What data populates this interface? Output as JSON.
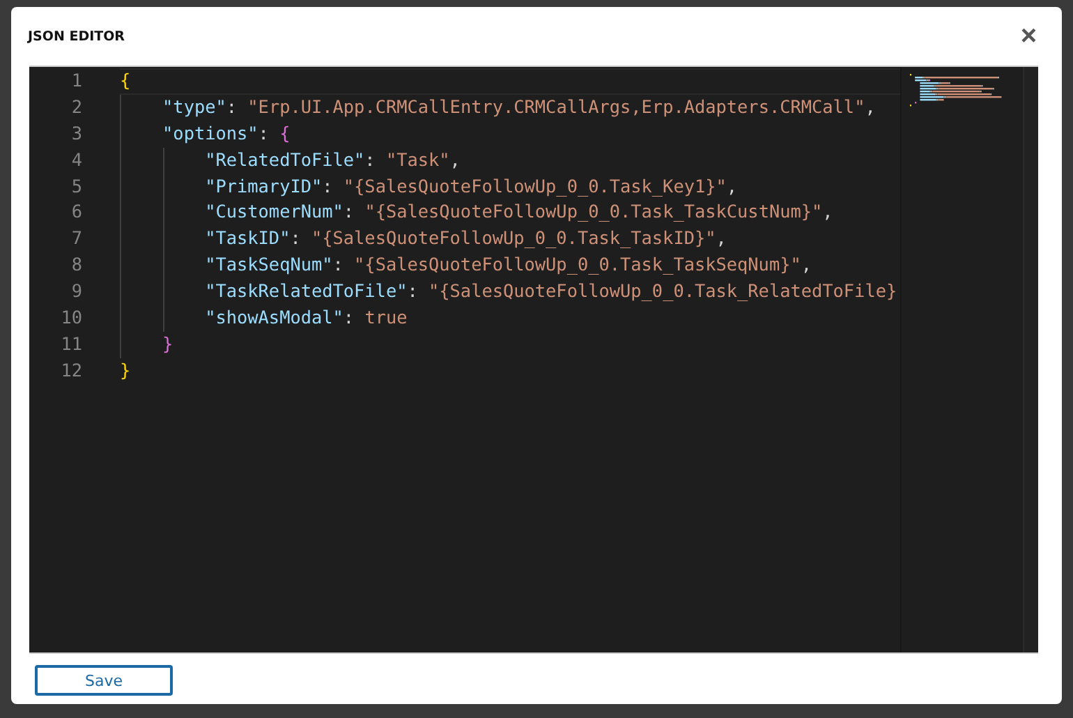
{
  "dialog": {
    "title": "JSON EDITOR",
    "close": "×"
  },
  "editor": {
    "lines": [
      {
        "number": "1",
        "current": true,
        "tokens": [
          {
            "kind": "brace",
            "text": "{",
            "color": "#ffd700"
          }
        ],
        "children": [
          {
            "number": "2",
            "current": false,
            "tokens": [
              {
                "kind": "key",
                "text": "\"type\""
              },
              {
                "kind": "punct",
                "text": ": "
              },
              {
                "kind": "string",
                "text": "\"Erp.UI.App.CRMCallEntry.CRMCallArgs,Erp.Adapters.CRMCall\""
              },
              {
                "kind": "punct",
                "text": ","
              }
            ]
          },
          {
            "number": "3",
            "current": false,
            "tokens": [
              {
                "kind": "key",
                "text": "\"options\""
              },
              {
                "kind": "punct",
                "text": ": "
              },
              {
                "kind": "brace",
                "text": "{",
                "color": "#da70d6"
              }
            ],
            "children": [
              {
                "number": "4",
                "current": false,
                "tokens": [
                  {
                    "kind": "key",
                    "text": "\"RelatedToFile\""
                  },
                  {
                    "kind": "punct",
                    "text": ": "
                  },
                  {
                    "kind": "string",
                    "text": "\"Task\""
                  },
                  {
                    "kind": "punct",
                    "text": ","
                  }
                ]
              },
              {
                "number": "5",
                "current": false,
                "tokens": [
                  {
                    "kind": "key",
                    "text": "\"PrimaryID\""
                  },
                  {
                    "kind": "punct",
                    "text": ": "
                  },
                  {
                    "kind": "string",
                    "text": "\"{SalesQuoteFollowUp_0_0.Task_Key1}\""
                  },
                  {
                    "kind": "punct",
                    "text": ","
                  }
                ]
              },
              {
                "number": "6",
                "current": false,
                "tokens": [
                  {
                    "kind": "key",
                    "text": "\"CustomerNum\""
                  },
                  {
                    "kind": "punct",
                    "text": ": "
                  },
                  {
                    "kind": "string",
                    "text": "\"{SalesQuoteFollowUp_0_0.Task_TaskCustNum}\""
                  },
                  {
                    "kind": "punct",
                    "text": ","
                  }
                ]
              },
              {
                "number": "7",
                "current": false,
                "tokens": [
                  {
                    "kind": "key",
                    "text": "\"TaskID\""
                  },
                  {
                    "kind": "punct",
                    "text": ": "
                  },
                  {
                    "kind": "string",
                    "text": "\"{SalesQuoteFollowUp_0_0.Task_TaskID}\""
                  },
                  {
                    "kind": "punct",
                    "text": ","
                  }
                ]
              },
              {
                "number": "8",
                "current": false,
                "tokens": [
                  {
                    "kind": "key",
                    "text": "\"TaskSeqNum\""
                  },
                  {
                    "kind": "punct",
                    "text": ": "
                  },
                  {
                    "kind": "string",
                    "text": "\"{SalesQuoteFollowUp_0_0.Task_TaskSeqNum}\""
                  },
                  {
                    "kind": "punct",
                    "text": ","
                  }
                ]
              },
              {
                "number": "9",
                "current": false,
                "tokens": [
                  {
                    "kind": "key",
                    "text": "\"TaskRelatedToFile\""
                  },
                  {
                    "kind": "punct",
                    "text": ": "
                  },
                  {
                    "kind": "string",
                    "text": "\"{SalesQuoteFollowUp_0_0.Task_RelatedToFile}"
                  }
                ]
              },
              {
                "number": "10",
                "current": false,
                "tokens": [
                  {
                    "kind": "key",
                    "text": "\"showAsModal\""
                  },
                  {
                    "kind": "punct",
                    "text": ": "
                  },
                  {
                    "kind": "literal",
                    "text": "true"
                  }
                ]
              }
            ]
          },
          {
            "number": "11",
            "current": false,
            "tokens": [
              {
                "kind": "brace",
                "text": "}",
                "color": "#da70d6"
              }
            ]
          }
        ]
      },
      {
        "number": "12",
        "current": false,
        "tokens": [
          {
            "kind": "brace",
            "text": "}",
            "color": "#ffd700"
          }
        ]
      }
    ]
  },
  "buttons": [
    {
      "label": "Save"
    }
  ]
}
